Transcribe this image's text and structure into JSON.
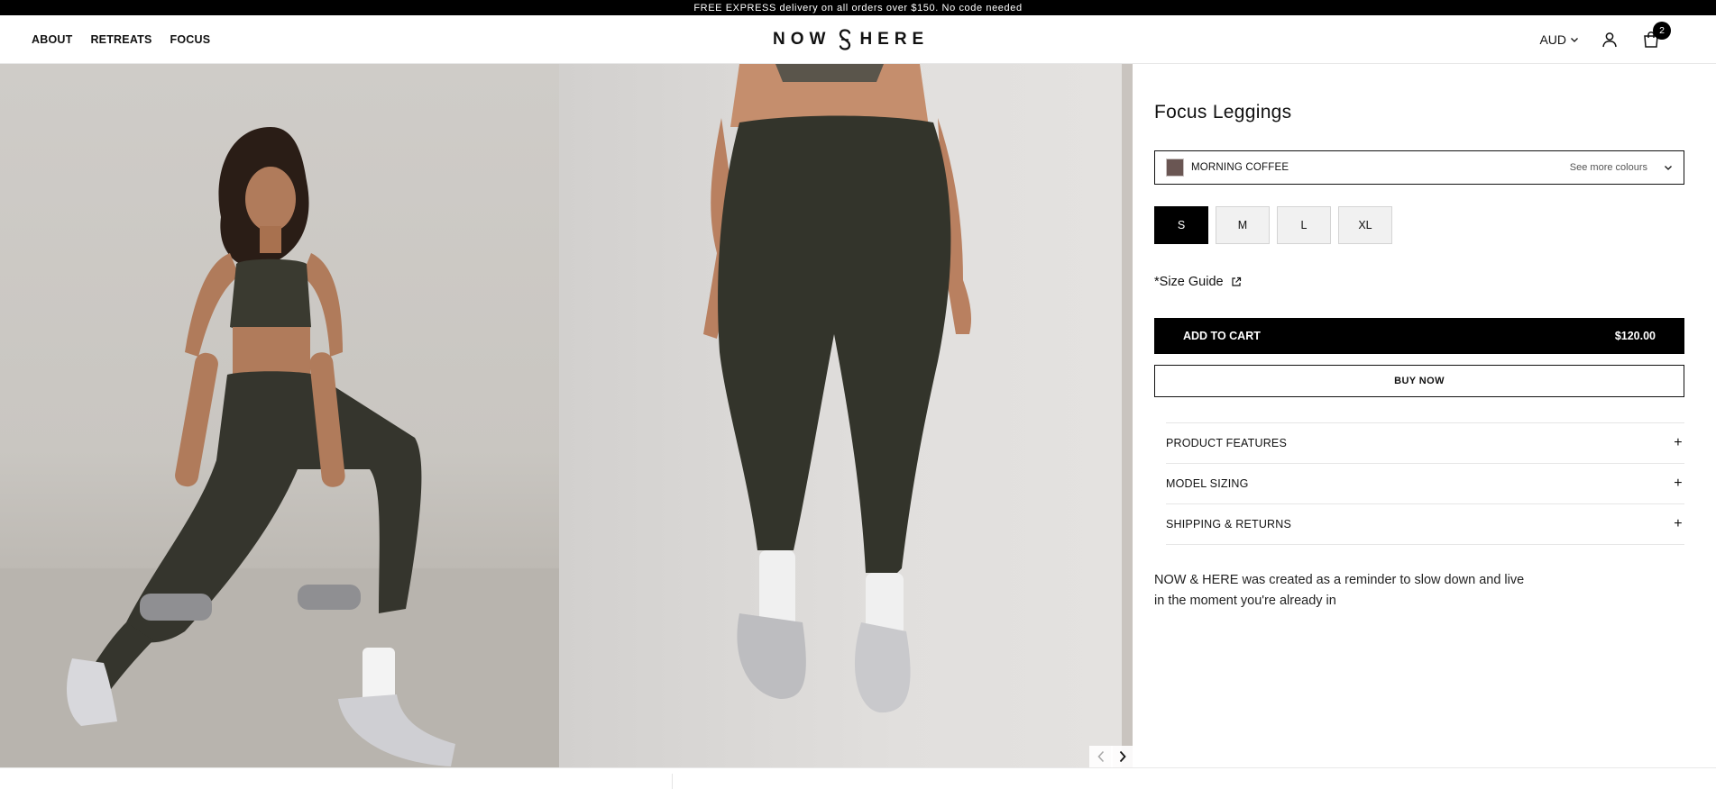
{
  "announcement": "FREE EXPRESS delivery on all orders over $150. No code needed",
  "nav": {
    "items": [
      "ABOUT",
      "RETREATS",
      "FOCUS"
    ]
  },
  "logo": {
    "left": "NOW",
    "right": "HERE",
    "mark_icon": "brand-s-mark-icon"
  },
  "header": {
    "currency": "AUD",
    "cart_count": "2",
    "icons": [
      "chevron-down-icon",
      "account-icon",
      "cart-icon"
    ]
  },
  "gallery": {
    "images": [
      "model-lunge-with-dumbbells",
      "model-leggings-standing"
    ],
    "controls": [
      "chevron-left-icon",
      "chevron-right-icon"
    ]
  },
  "product": {
    "title": "Focus Leggings",
    "colour": {
      "name": "MORNING COFFEE",
      "swatch": "#6a5653",
      "see_more": "See more colours"
    },
    "sizes": [
      "S",
      "M",
      "L",
      "XL"
    ],
    "selected_size": "S",
    "size_guide": "*Size Guide",
    "add_to_cart": "ADD TO CART",
    "price": "$120.00",
    "buy_now": "BUY NOW",
    "accordion": [
      "PRODUCT FEATURES",
      "MODEL SIZING",
      "SHIPPING & RETURNS"
    ],
    "tagline": "NOW & HERE was created as a reminder to slow down and live in the moment you're already in"
  },
  "colors": {
    "accent": "#000000",
    "background": "#ffffff",
    "swatch": "#6a5653"
  }
}
